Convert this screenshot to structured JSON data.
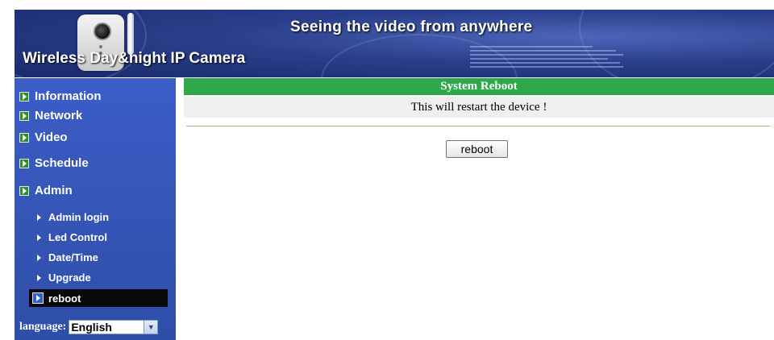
{
  "header": {
    "product_name": "Wireless Day&night IP Camera",
    "slogan": "Seeing the video from anywhere"
  },
  "sidebar": {
    "menu": [
      {
        "label": "Information"
      },
      {
        "label": "Network"
      },
      {
        "label": "Video"
      },
      {
        "label": "Schedule"
      },
      {
        "label": "Admin"
      }
    ],
    "admin_submenu": [
      {
        "label": "Admin login"
      },
      {
        "label": "Led Control"
      },
      {
        "label": "Date/Time"
      },
      {
        "label": "Upgrade"
      }
    ],
    "active_item": {
      "label": "reboot"
    },
    "language": {
      "label": "language:",
      "selected": "English"
    }
  },
  "main": {
    "title": "System Reboot",
    "message": "This will restart the device !",
    "reboot_button_label": "reboot"
  },
  "colors": {
    "sidebar_blue": "#3656bf",
    "title_green": "#2ea84a",
    "active_black": "#0a0a0a"
  }
}
